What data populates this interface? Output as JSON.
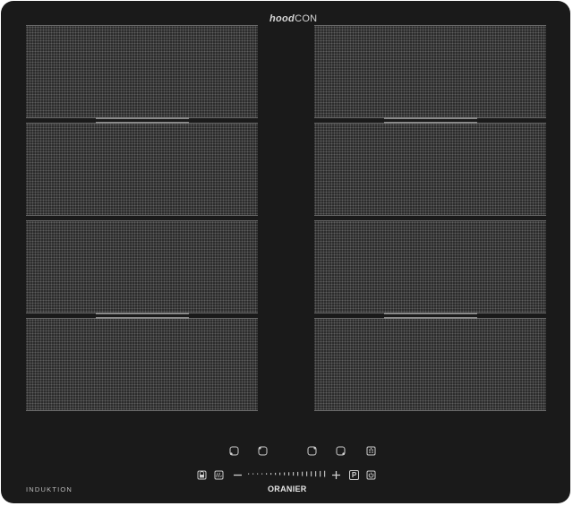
{
  "hob": {
    "hood_logo_bold": "hood",
    "hood_logo_light": "CON",
    "type_label": "INDUKTION",
    "brand": "ORANIER"
  },
  "zones": [
    {
      "side": "left",
      "row": 1
    },
    {
      "side": "left",
      "row": 2
    },
    {
      "side": "left",
      "row": 3
    },
    {
      "side": "left",
      "row": 4
    },
    {
      "side": "right",
      "row": 1
    },
    {
      "side": "right",
      "row": 2
    },
    {
      "side": "right",
      "row": 3
    },
    {
      "side": "right",
      "row": 4
    }
  ],
  "controls": {
    "zone_selectors": [
      "zone-rear-left-icon",
      "zone-front-left-icon",
      "zone-front-right-icon",
      "zone-rear-right-icon"
    ],
    "bridge_icon": "bridge-zone-icon",
    "lock_icon": "child-lock-icon",
    "keep_warm_icon": "keep-warm-icon",
    "minus_icon": "minus-icon",
    "plus_icon": "plus-icon",
    "power_boost_label": "P",
    "power_icon": "power-icon"
  },
  "colors": {
    "glass": "#1a1a1a",
    "zone_fill": "#2c2c2c",
    "zone_dots": "#5e5e5e",
    "symbols": "#cfcfcf"
  }
}
